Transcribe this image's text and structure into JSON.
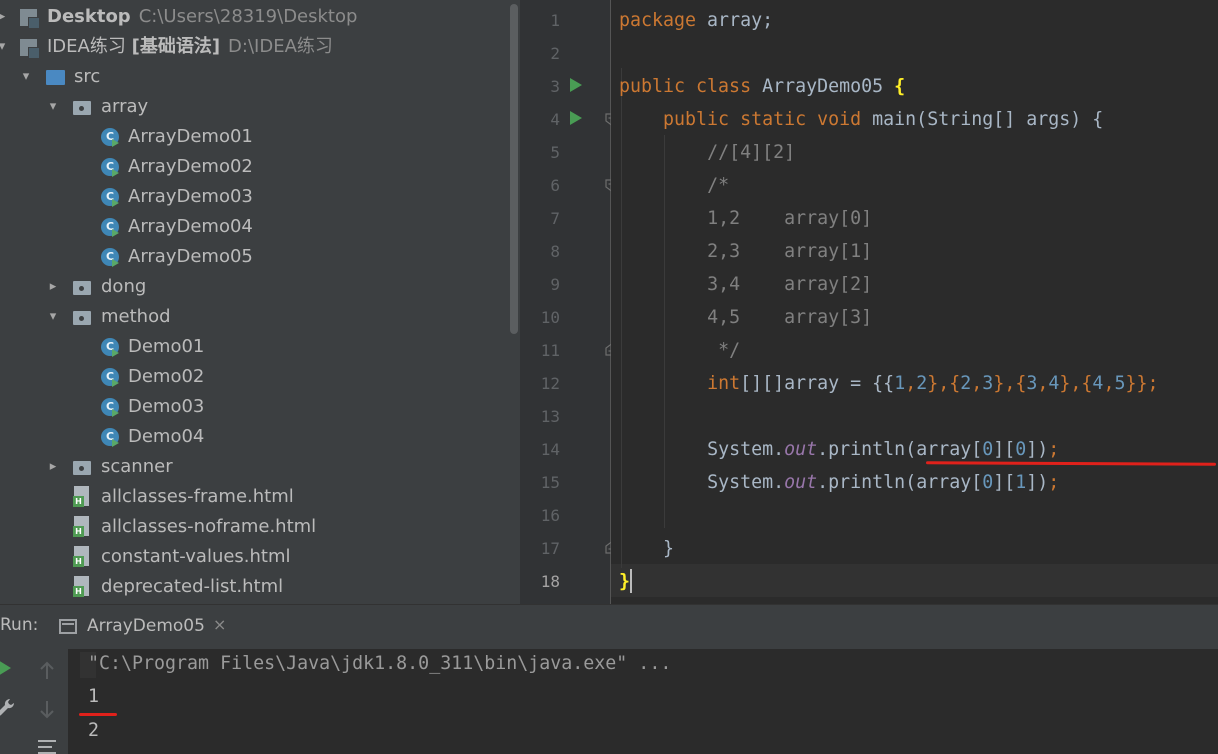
{
  "project_tree": {
    "items": [
      {
        "label": "Desktop",
        "path": "C:\\Users\\28319\\Desktop"
      },
      {
        "label": "IDEA练习",
        "label_bold": "[基础语法]",
        "path": "D:\\IDEA练习"
      },
      {
        "label": "src"
      },
      {
        "label": "array"
      },
      {
        "label": "ArrayDemo01"
      },
      {
        "label": "ArrayDemo02"
      },
      {
        "label": "ArrayDemo03"
      },
      {
        "label": "ArrayDemo04"
      },
      {
        "label": "ArrayDemo05"
      },
      {
        "label": "dong"
      },
      {
        "label": "method"
      },
      {
        "label": "Demo01"
      },
      {
        "label": "Demo02"
      },
      {
        "label": "Demo03"
      },
      {
        "label": "Demo04"
      },
      {
        "label": "scanner"
      },
      {
        "label": "allclasses-frame.html"
      },
      {
        "label": "allclasses-noframe.html"
      },
      {
        "label": "constant-values.html"
      },
      {
        "label": "deprecated-list.html"
      }
    ]
  },
  "editor": {
    "line_numbers": [
      "1",
      "2",
      "3",
      "4",
      "5",
      "6",
      "7",
      "8",
      "9",
      "10",
      "11",
      "12",
      "13",
      "14",
      "15",
      "16",
      "17",
      "18"
    ],
    "current_line": "18",
    "code": {
      "l1_kw": "package",
      "l1_rest": " array;",
      "l3_kw": "public class",
      "l3_name": " ArrayDemo05 ",
      "l3_brace": "{",
      "l4_kw": "public static void",
      "l4_rest": " main(String[] args) {",
      "l5": "//[4][2]",
      "l6": "/*",
      "l7": "1,2    array[0]",
      "l8": "2,3    array[1]",
      "l9": "3,4    array[2]",
      "l10": "4,5    array[3]",
      "l11": " */",
      "l12_kw": "int",
      "l12_a": "[][]array = {{",
      "l12_n1": "1",
      "l12_c1": ",",
      "l12_n2": "2",
      "l12_b1": "},{",
      "l12_n3": "2",
      "l12_c2": ",",
      "l12_n4": "3",
      "l12_b2": "},{",
      "l12_n5": "3",
      "l12_c3": ",",
      "l12_n6": "4",
      "l12_b3": "},{",
      "l12_n7": "4",
      "l12_c4": ",",
      "l12_n8": "5",
      "l12_end": "}};",
      "l14_a": "System.",
      "l14_out": "out",
      "l14_b": ".println(array[",
      "l14_n1": "0",
      "l14_c": "][",
      "l14_n2": "0",
      "l14_end": "])",
      "l14_semi": ";",
      "l15_a": "System.",
      "l15_out": "out",
      "l15_b": ".println(array[",
      "l15_n1": "0",
      "l15_c": "][",
      "l15_n2": "1",
      "l15_end": "])",
      "l15_semi": ";",
      "l17": "}",
      "l18": "}"
    }
  },
  "run_panel": {
    "label": "Run:",
    "tab_label": "ArrayDemo05",
    "tab_close": "×",
    "console": [
      "\"C:\\Program Files\\Java\\jdk1.8.0_311\\bin\\java.exe\" ...",
      "1",
      "2"
    ]
  }
}
